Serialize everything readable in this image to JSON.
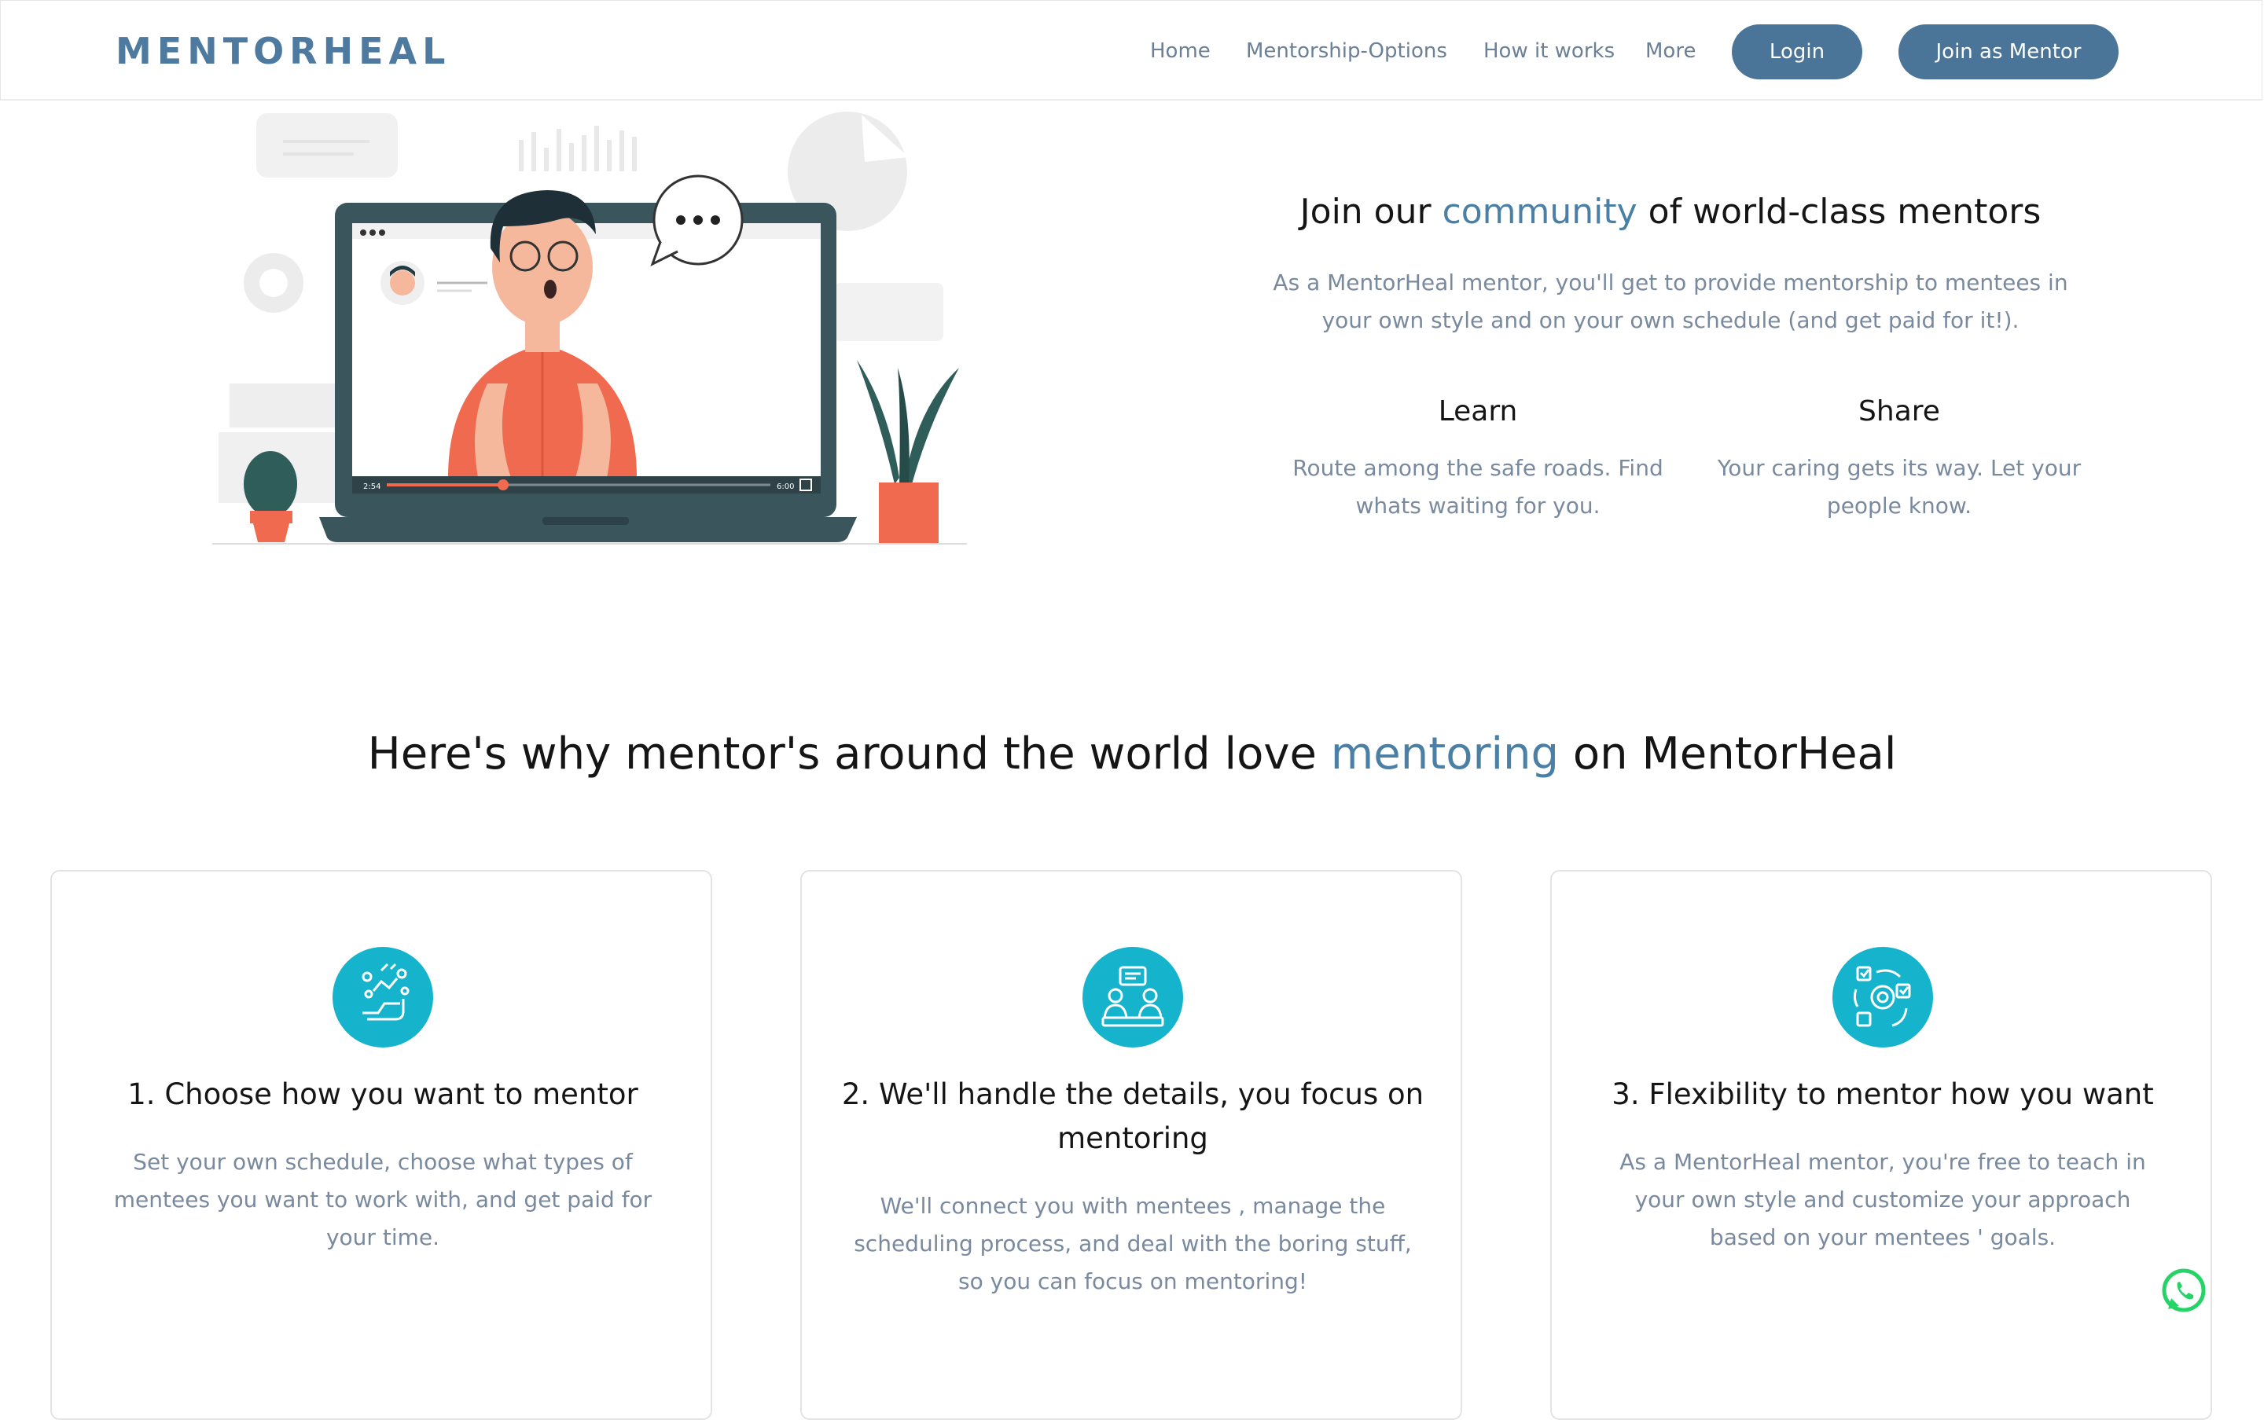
{
  "brand": {
    "logo_text": "MENTORHEAL"
  },
  "nav": {
    "links": [
      "Home",
      "Mentorship-Options",
      "How it works",
      "More"
    ],
    "login_label": "Login",
    "join_label": "Join as Mentor"
  },
  "hero": {
    "title_prefix": "Join our ",
    "title_accent": "community",
    "title_suffix": " of world-class mentors",
    "description": "As a MentorHeal mentor, you'll get to provide mentorship to mentees in your own style and on your own schedule (and get paid for it!).",
    "video_time_current": "2:54",
    "video_time_total": "6:00",
    "features": [
      {
        "title": "Learn",
        "text": "Route among the safe roads. Find whats waiting for you."
      },
      {
        "title": "Share",
        "text": "Your caring gets its way. Let your people know."
      }
    ]
  },
  "why": {
    "title_prefix": "Here's why mentor's around the world love ",
    "title_accent": "mentoring",
    "title_suffix": " on MentorHeal",
    "cards": [
      {
        "icon": "handshake-icon",
        "title": "1. Choose how you want to mentor",
        "text": "Set your own schedule, choose what types of mentees you want to work with, and get paid for your time."
      },
      {
        "icon": "meeting-icon",
        "title": "2. We'll handle the details, you focus on mentoring",
        "text": "We'll connect you with mentees , manage the scheduling process, and deal with the boring stuff, so you can focus on mentoring!"
      },
      {
        "icon": "flexibility-gear-icon",
        "title": "3. Flexibility to mentor how you want",
        "text": "As a MentorHeal mentor, you're free to teach in your own style and customize your approach based on your mentees ' goals."
      }
    ]
  },
  "colors": {
    "accent": "#4a7fa6",
    "button": "#4b7598",
    "icon_bg": "#15b3cc",
    "whatsapp": "#25d366"
  }
}
